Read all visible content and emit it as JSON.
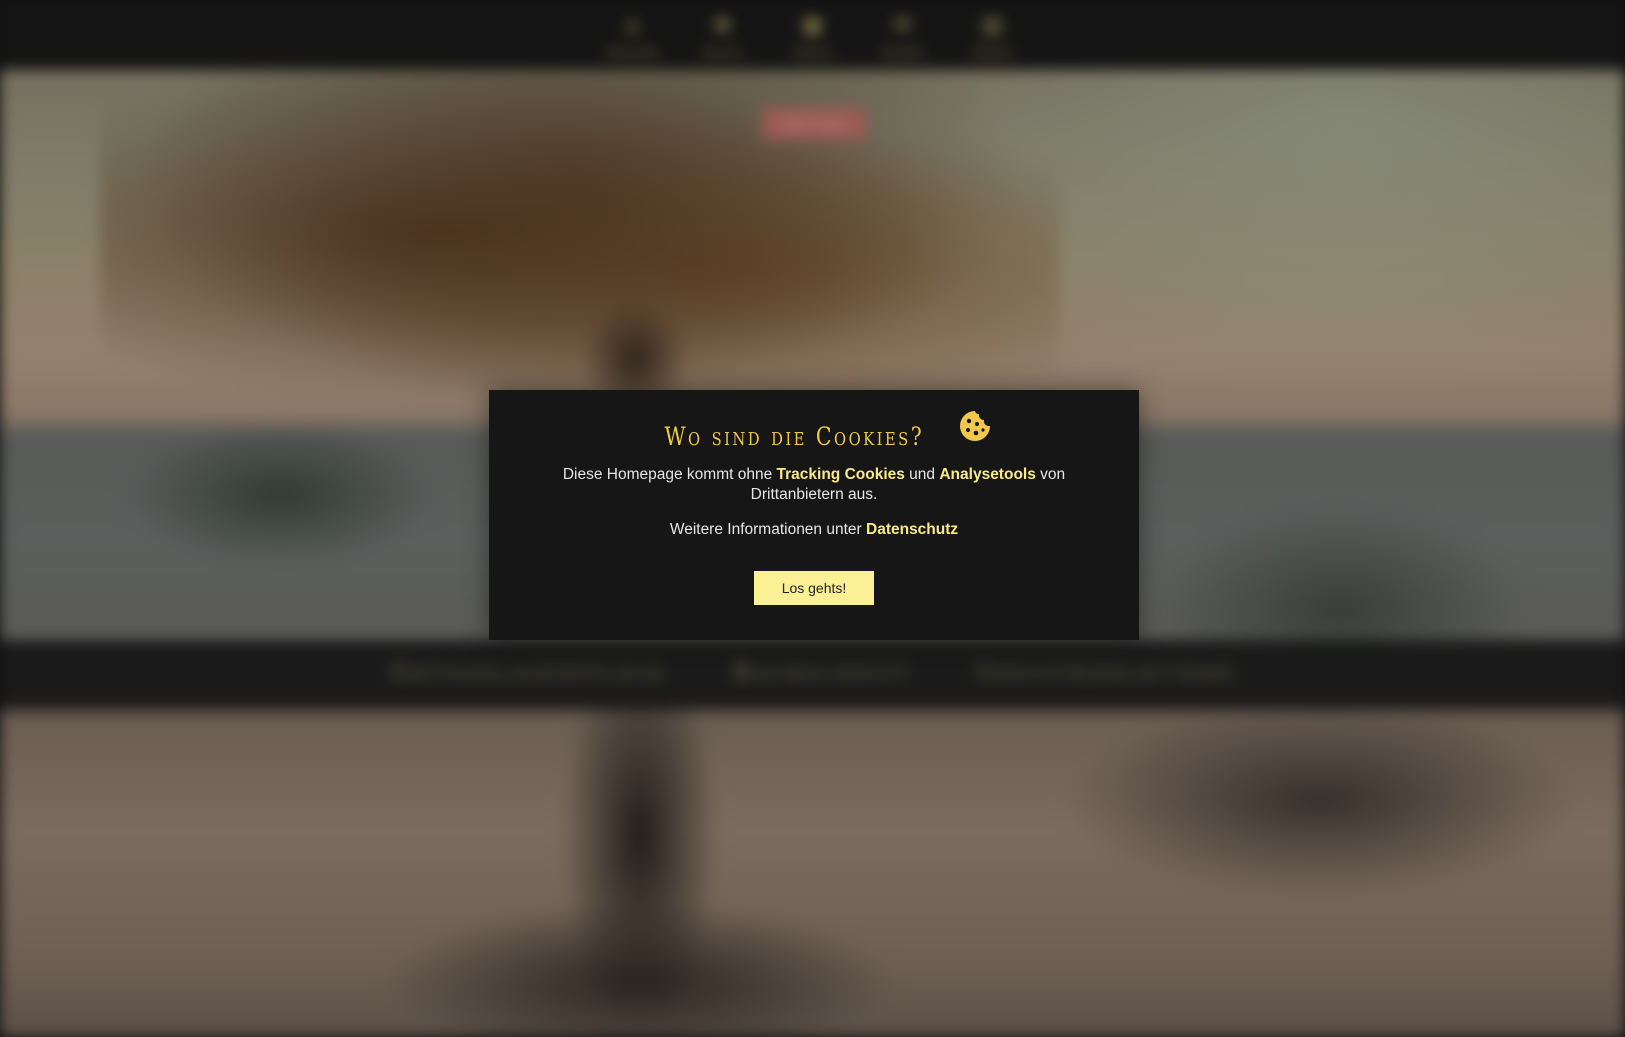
{
  "nav": {
    "items": [
      {
        "label": "Startseite",
        "icon": "home-icon"
      },
      {
        "label": "Service",
        "icon": "sprout-icon"
      },
      {
        "label": "Galerie",
        "icon": "gallery-icon"
      },
      {
        "label": "Kontakt",
        "icon": "mail-icon"
      },
      {
        "label": "Wissen",
        "icon": "book-icon"
      }
    ]
  },
  "hero": {
    "badge_label": "mehr lesen"
  },
  "services": {
    "items": [
      "Grünanlagenpflege",
      "Baumschnitt",
      "Industrieklettern"
    ]
  },
  "cookie_dialog": {
    "title": "Wo sind die Cookies?",
    "text_before": "Diese Homepage kommt ohne ",
    "link_tracking": "Tracking Cookies",
    "text_and": " und ",
    "link_analytics": "Analysetools",
    "text_after": " von Drittanbietern aus.",
    "info_prefix": "Weitere Informationen unter ",
    "link_privacy": "Datenschutz",
    "accept_label": "Los gehts!",
    "accent_color": "#f2c84a",
    "button_color": "#fbf096"
  }
}
